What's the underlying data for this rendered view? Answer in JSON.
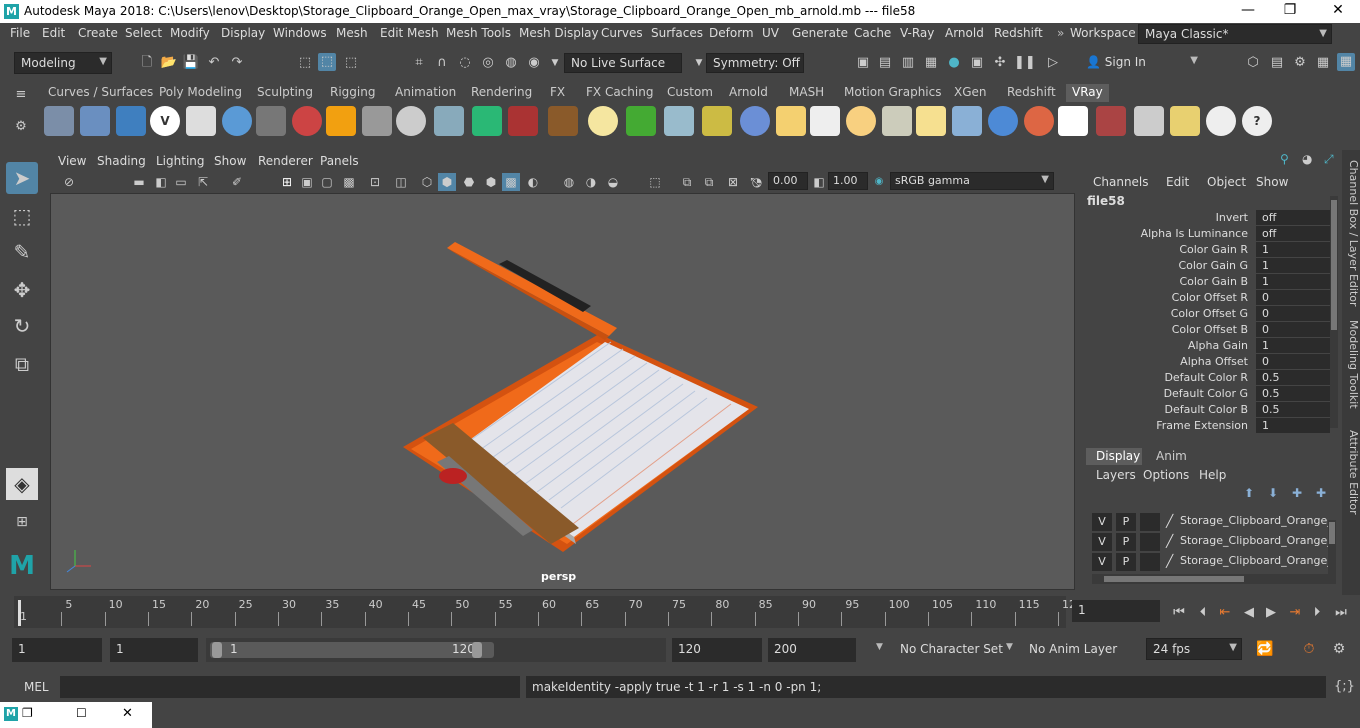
{
  "window": {
    "title": "Autodesk Maya 2018: C:\\Users\\lenov\\Desktop\\Storage_Clipboard_Orange_Open_max_vray\\Storage_Clipboard_Orange_Open_mb_arnold.mb  ---  file58",
    "logo": "M",
    "minimize": "—",
    "maximize": "❐",
    "close": "✕"
  },
  "menubar": {
    "items": [
      "File",
      "Edit",
      "Create",
      "Select",
      "Modify",
      "Display",
      "Windows",
      "Mesh",
      "Edit Mesh",
      "Mesh Tools",
      "Mesh Display",
      "Curves",
      "Surfaces",
      "Deform",
      "UV",
      "Generate",
      "Cache",
      "V-Ray",
      "Arnold",
      "Redshift"
    ],
    "workspace_label": "Workspace :",
    "workspace_value": "Maya Classic*"
  },
  "statusline": {
    "mode": "Modeling",
    "live_surface": "No Live Surface",
    "symmetry": "Symmetry: Off",
    "sign_in": "Sign In"
  },
  "shelf": {
    "tabs": [
      "Curves / Surfaces",
      "Poly Modeling",
      "Sculpting",
      "Rigging",
      "Animation",
      "Rendering",
      "FX",
      "FX Caching",
      "Custom",
      "Arnold",
      "MASH",
      "Motion Graphics",
      "XGen",
      "Redshift",
      "VRay"
    ],
    "active_tab": "VRay"
  },
  "viewport": {
    "menus": [
      "View",
      "Shading",
      "Lighting",
      "Show",
      "Renderer",
      "Panels"
    ],
    "exposure": "0.00",
    "gamma": "1.00",
    "color_space": "sRGB gamma",
    "camera_label": "persp"
  },
  "channelbox": {
    "menus": [
      "Channels",
      "Edit",
      "Object",
      "Show"
    ],
    "node": "file58",
    "attributes": [
      {
        "label": "Invert",
        "value": "off"
      },
      {
        "label": "Alpha Is Luminance",
        "value": "off"
      },
      {
        "label": "Color Gain R",
        "value": "1"
      },
      {
        "label": "Color Gain G",
        "value": "1"
      },
      {
        "label": "Color Gain B",
        "value": "1"
      },
      {
        "label": "Color Offset R",
        "value": "0"
      },
      {
        "label": "Color Offset G",
        "value": "0"
      },
      {
        "label": "Color Offset B",
        "value": "0"
      },
      {
        "label": "Alpha Gain",
        "value": "1"
      },
      {
        "label": "Alpha Offset",
        "value": "0"
      },
      {
        "label": "Default Color R",
        "value": "0.5"
      },
      {
        "label": "Default Color G",
        "value": "0.5"
      },
      {
        "label": "Default Color B",
        "value": "0.5"
      },
      {
        "label": "Frame Extension",
        "value": "1"
      }
    ]
  },
  "sidetabs": [
    "Channel Box / Layer Editor",
    "Modeling Toolkit",
    "Attribute Editor"
  ],
  "layers": {
    "tabs": [
      "Display",
      "Anim"
    ],
    "menus": [
      "Layers",
      "Options",
      "Help"
    ],
    "rows": [
      {
        "v": "V",
        "p": "P",
        "name": "Storage_Clipboard_Orange_"
      },
      {
        "v": "V",
        "p": "P",
        "name": "Storage_Clipboard_Orange_"
      },
      {
        "v": "V",
        "p": "P",
        "name": "Storage_Clipboard_Orange_"
      }
    ]
  },
  "timeline": {
    "ticks": [
      "1",
      "5",
      "10",
      "15",
      "20",
      "25",
      "30",
      "35",
      "40",
      "45",
      "50",
      "55",
      "60",
      "65",
      "70",
      "75",
      "80",
      "85",
      "90",
      "95",
      "100",
      "105",
      "110",
      "115",
      "12"
    ],
    "current_frame": "1"
  },
  "range": {
    "start": "1",
    "playback_start": "1",
    "slider_start": "1",
    "slider_end": "120",
    "playback_end": "120",
    "end": "200",
    "character_set": "No Character Set",
    "anim_layer": "No Anim Layer",
    "fps": "24 fps"
  },
  "mel": {
    "label": "MEL",
    "result": "makeIdentity -apply true -t 1 -r 1 -s 1 -n 0 -pn 1;"
  },
  "colors": {
    "accent": "#5285a6",
    "clipboard_orange": "#f06a1a"
  }
}
